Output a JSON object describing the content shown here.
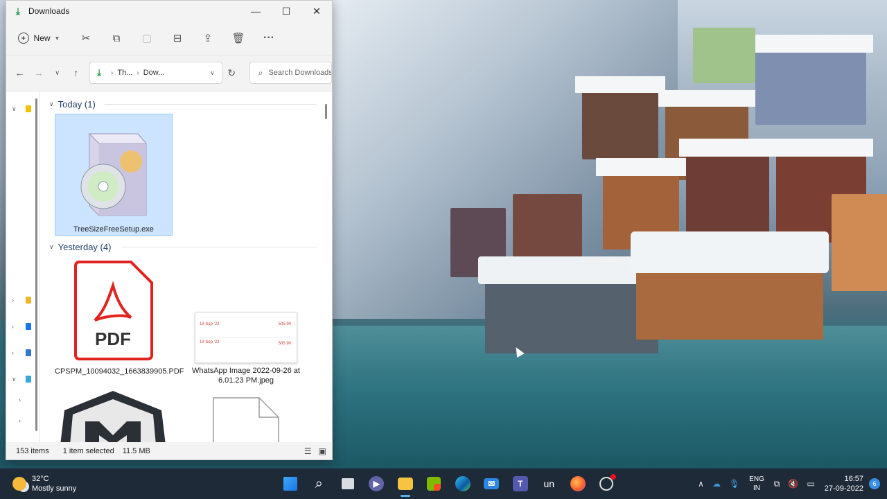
{
  "window": {
    "title": "Downloads",
    "controls": {
      "minimize": "—",
      "maximize": "☐",
      "close": "✕"
    }
  },
  "toolbar": {
    "new_label": "New",
    "more": "···"
  },
  "navigation": {
    "breadcrumb": [
      "Th...",
      "Dow..."
    ],
    "search_placeholder": "Search Downloads"
  },
  "groups": [
    {
      "label": "Today (1)"
    },
    {
      "label": "Yesterday (4)"
    }
  ],
  "files": [
    {
      "name": "TreeSizeFreeSetup.exe",
      "selected": true
    },
    {
      "name": "CPSPM_10094032_1663839905.PDF",
      "selected": false,
      "icon_text": "PDF"
    },
    {
      "name": "WhatsApp Image 2022-09-26 at 6.01.23 PM.jpeg",
      "selected": false,
      "thumb_rows": [
        {
          "date": "19 Sep '22",
          "amount": "505.90"
        },
        {
          "date": "19 Sep '22",
          "amount": "505.90"
        }
      ]
    },
    {
      "name": "",
      "selected": false
    },
    {
      "name": "",
      "selected": false
    }
  ],
  "status": {
    "item_count": "153 items",
    "selection": "1 item selected",
    "size": "11.5 MB"
  },
  "taskbar": {
    "weather_temp": "32°C",
    "weather_desc": "Mostly sunny",
    "lang_line1": "ENG",
    "lang_line2": "IN",
    "time": "16:57",
    "date": "27-09-2022",
    "notification_count": "6",
    "app_text_un": "un"
  }
}
